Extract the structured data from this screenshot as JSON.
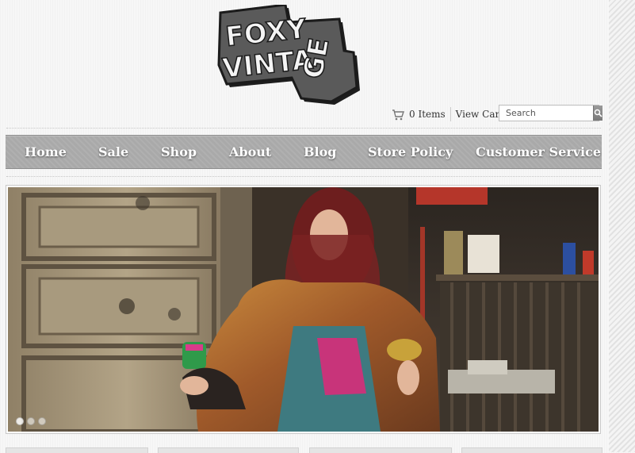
{
  "brand": {
    "logo_line1": "FOXY",
    "logo_line2": "VINTA",
    "logo_line3": "GE"
  },
  "cart": {
    "icon": "cart-icon",
    "items_label": "0 Items",
    "view_cart_label": "View Cart"
  },
  "search": {
    "placeholder": "Search",
    "icon": "search-icon"
  },
  "nav": {
    "items": [
      {
        "label": "Home"
      },
      {
        "label": "Sale"
      },
      {
        "label": "Shop"
      },
      {
        "label": "About"
      },
      {
        "label": "Blog"
      },
      {
        "label": "Store Policy"
      },
      {
        "label": "Customer Service"
      }
    ]
  },
  "slider": {
    "slide_count": 3,
    "active_slide": 1
  },
  "colors": {
    "nav_bg": "#a9a9a9",
    "nav_text": "#ffffff",
    "logo_fill": "#4a4a4a"
  }
}
